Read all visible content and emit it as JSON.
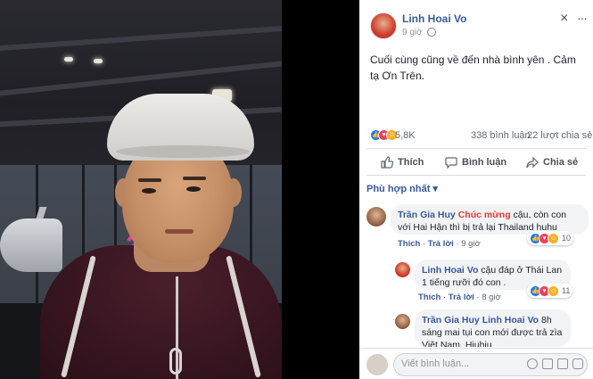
{
  "post": {
    "author": "Linh Hoai Vo",
    "time": "9 giờ",
    "text": "Cuối cùng cũng về đến nhà bình yên . Cảm tạ Ơn Trên.",
    "reactions_count": "5,8K",
    "comments_count": "338 bình luận",
    "shares_count": "22 lượt chia sẻ",
    "close_glyph": "×",
    "more_glyph": "···"
  },
  "actions": {
    "like": "Thích",
    "comment": "Bình luận",
    "share": "Chia sẻ"
  },
  "sort_label": "Phù hợp nhất ▾",
  "comments": [
    {
      "name": "Trần Gia Huy",
      "tag": "Chúc mừng",
      "text": " cậu, còn con với Hai Hận thì bị trả lại Thailand huhu",
      "like": "Thích",
      "reply": "Trả lời",
      "time": "9 giờ",
      "reaction_count": "10"
    },
    {
      "name": "Linh Hoai Vo",
      "text": " cậu đáp ở Thái Lan 1 tiếng rưỡi đó con .",
      "like": "Thích",
      "reply": "Trả lời",
      "time": "8 giờ",
      "reaction_count": "11"
    },
    {
      "name": "Trần Gia Huy",
      "tag": "Linh Hoai Vo",
      "text": " 8h sáng mai tụi con mới được trả zìa Việt Nam. Hiuhiu"
    }
  ],
  "composer": {
    "placeholder": "Viết bình luận..."
  },
  "colors": {
    "link": "#385898",
    "tag_red": "#e53935",
    "like_blue": "#2078f4",
    "love_red": "#f33e58",
    "haha_yellow": "#f7b125"
  },
  "icons": [
    "like-icon",
    "love-icon",
    "haha-icon",
    "globe-icon",
    "thumb-icon",
    "speech-bubble-icon",
    "share-arrow-icon",
    "emoji-icon",
    "camera-icon",
    "gif-icon",
    "sticker-icon"
  ]
}
